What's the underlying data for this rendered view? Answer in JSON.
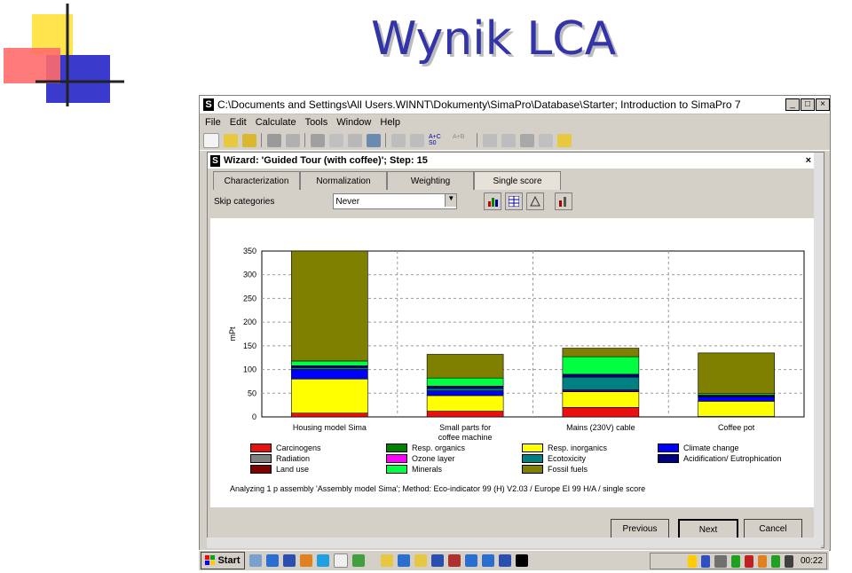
{
  "slide": {
    "title": "Wynik LCA"
  },
  "window": {
    "title": "C:\\Documents and Settings\\All Users.WINNT\\Dokumenty\\SimaPro\\Database\\Starter; Introduction to SimaPro 7",
    "menu": [
      "File",
      "Edit",
      "Calculate",
      "Tools",
      "Window",
      "Help"
    ],
    "toolbar_text": {
      "az": "A+C\nS0",
      "az2": "A+B"
    }
  },
  "wizard": {
    "title": "Wizard: 'Guided Tour (with coffee)';  Step: 15",
    "tabs": [
      {
        "label": "Characterization",
        "active": false
      },
      {
        "label": "Normalization",
        "active": false
      },
      {
        "label": "Weighting",
        "active": false
      },
      {
        "label": "Single score",
        "active": true
      }
    ],
    "skip_label": "Skip categories",
    "skip_value": "Never",
    "analyzing": "Analyzing 1 p assembly 'Assembly model Sima';  Method: Eco-indicator 99 (H) V2.03 / Europe EI 99 H/A / single score",
    "buttons": {
      "previous": "Previous",
      "next": "Next",
      "cancel": "Cancel"
    }
  },
  "chart_data": {
    "type": "bar",
    "stacked": true,
    "ylabel": "mPt",
    "ylim": [
      0,
      350
    ],
    "yticks": [
      0,
      50,
      100,
      150,
      200,
      250,
      300,
      350
    ],
    "grid": true,
    "categories": [
      "Housing model Sima",
      "Small parts for coffee machine",
      "Mains (230V) cable",
      "Coffee pot"
    ],
    "series": [
      {
        "name": "Carcinogens",
        "color": "#e81010",
        "values": [
          8,
          12,
          20,
          1
        ]
      },
      {
        "name": "Resp. organics",
        "color": "#008000",
        "values": [
          0,
          0,
          0,
          0
        ]
      },
      {
        "name": "Resp. inorganics",
        "color": "#ffff00",
        "values": [
          72,
          33,
          33,
          32
        ]
      },
      {
        "name": "Climate change",
        "color": "#0000ff",
        "values": [
          20,
          10,
          2,
          9
        ]
      },
      {
        "name": "Radiation",
        "color": "#808080",
        "values": [
          0,
          0,
          0,
          0
        ]
      },
      {
        "name": "Ozone layer",
        "color": "#ff00ff",
        "values": [
          0,
          0,
          2,
          0
        ]
      },
      {
        "name": "Ecotoxicity",
        "color": "#008080",
        "values": [
          4,
          5,
          27,
          1
        ]
      },
      {
        "name": "Acidification/ Eutrophication",
        "color": "#000080",
        "values": [
          4,
          5,
          6,
          3
        ]
      },
      {
        "name": "Land use",
        "color": "#800000",
        "values": [
          0,
          0,
          0,
          0
        ]
      },
      {
        "name": "Minerals",
        "color": "#00ff40",
        "values": [
          10,
          17,
          37,
          3
        ]
      },
      {
        "name": "Fossil fuels",
        "color": "#808000",
        "values": [
          232,
          50,
          18,
          86
        ]
      }
    ]
  },
  "taskbar": {
    "start": "Start",
    "clock": "00:22"
  }
}
